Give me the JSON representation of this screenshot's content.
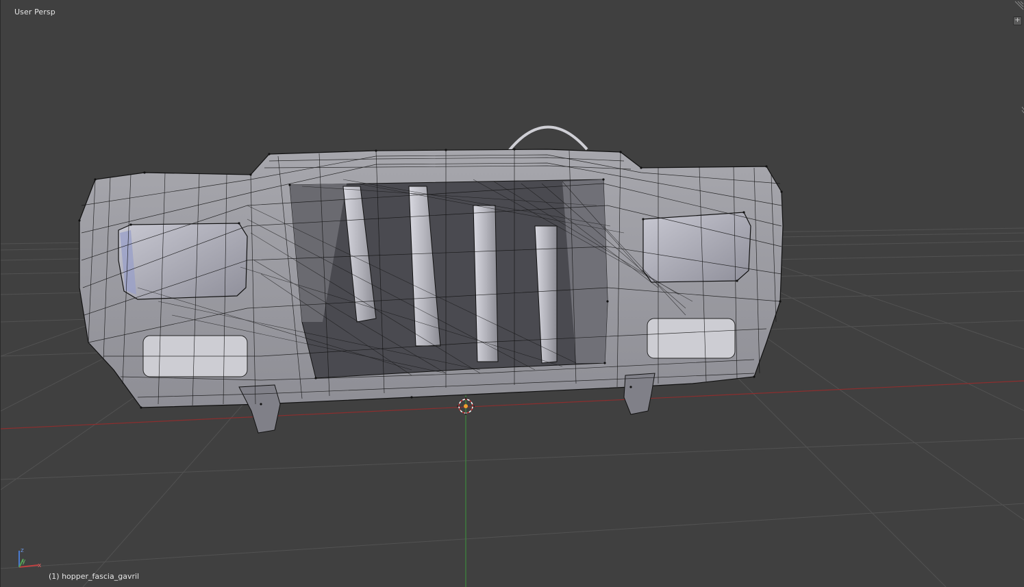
{
  "viewport": {
    "view_label": "User Persp",
    "object_label": "(1) hopper_fascia_gavril"
  },
  "axes": {
    "z_label": "z",
    "y_label": "y",
    "x_label": "x"
  },
  "colors": {
    "background": "#404040",
    "grid": "#525252",
    "x_axis": "#8c2e2e",
    "y_axis": "#3d8a3d",
    "mesh_fill": "#9a9aa2",
    "wire": "#111111"
  },
  "icons": {
    "region_toggle": "plus-icon",
    "cursor": "3d-cursor-icon"
  }
}
